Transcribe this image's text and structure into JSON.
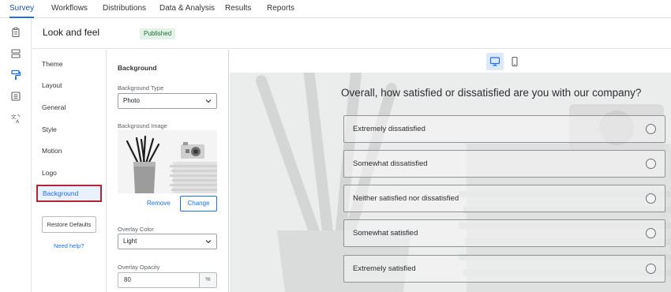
{
  "topnav": {
    "tabs": [
      "Survey",
      "Workflows",
      "Distributions",
      "Data & Analysis",
      "Results",
      "Reports"
    ],
    "active_tab": "Survey"
  },
  "iconrail": {
    "icons": [
      "clipboard-icon",
      "layout-blocks-icon",
      "paint-roller-icon",
      "checklist-icon",
      "translate-icon"
    ],
    "active_icon": "paint-roller-icon"
  },
  "header": {
    "title": "Look and feel",
    "status_badge": "Published"
  },
  "settings_nav": {
    "items": [
      "Theme",
      "Layout",
      "General",
      "Style",
      "Motion",
      "Logo",
      "Background"
    ],
    "selected_item": "Background",
    "restore_label": "Restore Defaults",
    "help_label": "Need help?"
  },
  "panel": {
    "title": "Background",
    "background_type_label": "Background Type",
    "background_type_value": "Photo",
    "background_image_label": "Background Image",
    "remove_label": "Remove",
    "change_label": "Change",
    "overlay_color_label": "Overlay Color",
    "overlay_color_value": "Light",
    "overlay_opacity_label": "Overlay Opacity",
    "overlay_opacity_value": "80",
    "overlay_opacity_unit": "%"
  },
  "preview": {
    "device_toggle": [
      "desktop-icon",
      "mobile-icon"
    ],
    "active_device": "desktop-icon",
    "question": "Overall, how satisfied or dissatisfied are you with our company?",
    "choices": [
      "Extremely dissatisfied",
      "Somewhat dissatisfied",
      "Neither satisfied nor dissatisfied",
      "Somewhat satisfied",
      "Extremely satisfied"
    ]
  },
  "colors": {
    "accent": "#1f6fe5",
    "selection_border": "#b12534",
    "badge_bg": "#e3f2e7",
    "badge_text": "#1f6a35"
  }
}
